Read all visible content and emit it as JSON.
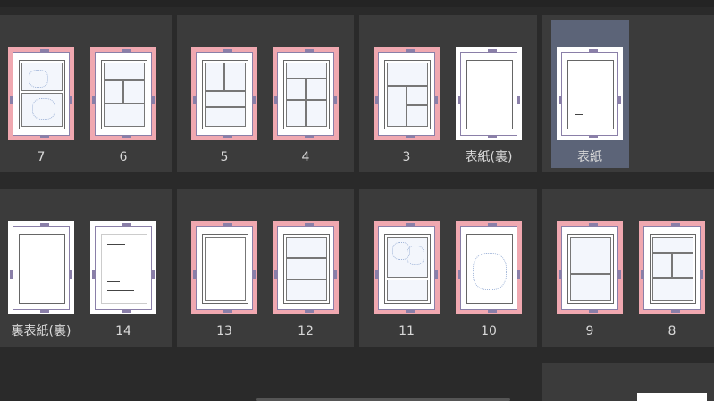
{
  "row1": [
    {
      "label": "7"
    },
    {
      "label": "6"
    },
    {
      "label": "5"
    },
    {
      "label": "4"
    },
    {
      "label": "3"
    },
    {
      "label": "表紙(裏)"
    },
    {
      "label": "表紙"
    }
  ],
  "row2": [
    {
      "label": "裏表紙(裏)"
    },
    {
      "label": "14"
    },
    {
      "label": "13"
    },
    {
      "label": "12"
    },
    {
      "label": "11"
    },
    {
      "label": "10"
    },
    {
      "label": "9"
    },
    {
      "label": "8"
    }
  ],
  "colors": {
    "background": "#2a2a2a",
    "spread": "#3b3b3b",
    "selection": "#5c6478",
    "bleed": "#f0a8b0"
  }
}
